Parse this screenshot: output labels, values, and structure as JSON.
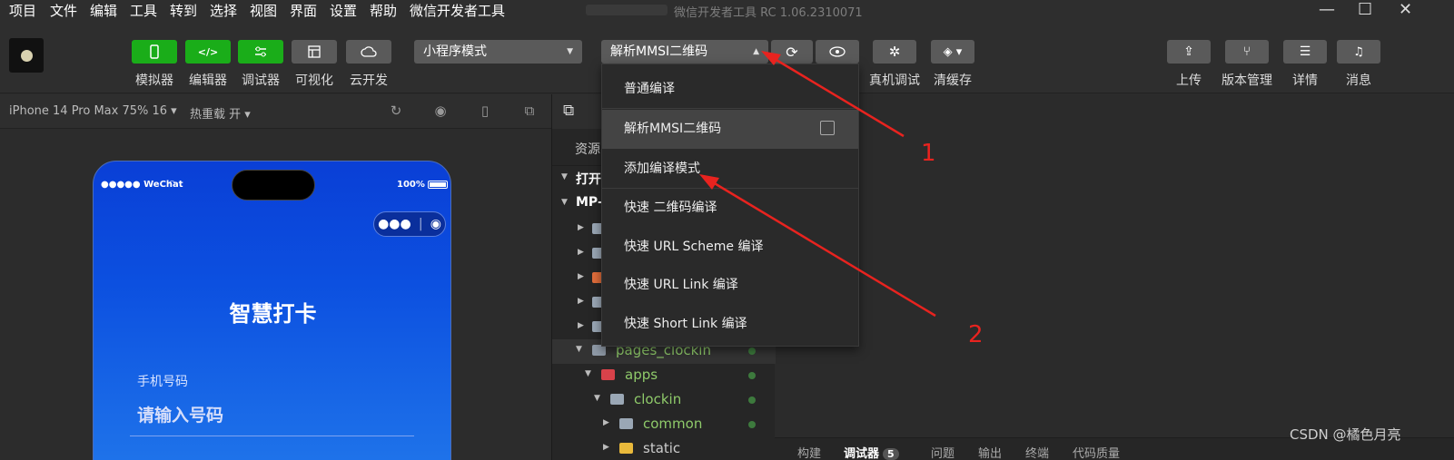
{
  "menubar": {
    "items": [
      "项目",
      "文件",
      "编辑",
      "工具",
      "转到",
      "选择",
      "视图",
      "界面",
      "设置",
      "帮助",
      "微信开发者工具"
    ],
    "window_title": "微信开发者工具 RC 1.06.2310071",
    "minimize_glyph": "—",
    "maximize_glyph": "☐",
    "close_glyph": "✕"
  },
  "toolbar": {
    "left_buttons": [
      {
        "label": "模拟器",
        "icon": "phone-icon"
      },
      {
        "label": "编辑器",
        "icon": "code-icon"
      },
      {
        "label": "调试器",
        "icon": "sliders-icon"
      },
      {
        "label": "可视化",
        "icon": "layout-icon"
      },
      {
        "label": "云开发",
        "icon": "cloud-icon"
      }
    ],
    "mode_select": "小程序模式",
    "compile_select": "解析MMSI二维码",
    "right_labels": [
      "真机调试",
      "清缓存"
    ],
    "far_right": [
      {
        "label": "上传",
        "icon": "upload-icon"
      },
      {
        "label": "版本管理",
        "icon": "branch-icon"
      },
      {
        "label": "详情",
        "icon": "menu-icon"
      },
      {
        "label": "消息",
        "icon": "bell-icon"
      }
    ]
  },
  "simbar": {
    "device": "iPhone 14 Pro Max 75% 16",
    "hot_reload": "热重载 开"
  },
  "phone": {
    "carrier": "●●●●● WeChat",
    "battery": "100%",
    "title": "智慧打卡",
    "field_label": "手机号码",
    "field_placeholder": "请输入号码"
  },
  "explorer": {
    "tab": "资源",
    "open_section": "打开",
    "project_section": "MP-",
    "tree": [
      {
        "label": "pages_clockin",
        "depth": 0,
        "green": true
      },
      {
        "label": "apps",
        "depth": 1,
        "green": true
      },
      {
        "label": "clockin",
        "depth": 2,
        "green": true
      },
      {
        "label": "common",
        "depth": 3,
        "green": true
      },
      {
        "label": "static",
        "depth": 3,
        "green": false
      }
    ]
  },
  "dropdown": {
    "items": [
      "普通编译",
      "解析MMSI二维码",
      "添加编译模式",
      "快速 二维码编译",
      "快速 URL Scheme 编译",
      "快速 URL Link 编译",
      "快速 Short Link 编译"
    ]
  },
  "bottom_tabs": [
    "构建",
    "调试器",
    "问题",
    "输出",
    "终端",
    "代码质量"
  ],
  "debugger_badge": "5",
  "annotations": [
    "1",
    "2"
  ],
  "watermark": "CSDN @橘色月亮",
  "colors": {
    "accent_green": "#1aad19",
    "arrow_red": "#e8231f",
    "phone_blue": "#0c50e0"
  }
}
